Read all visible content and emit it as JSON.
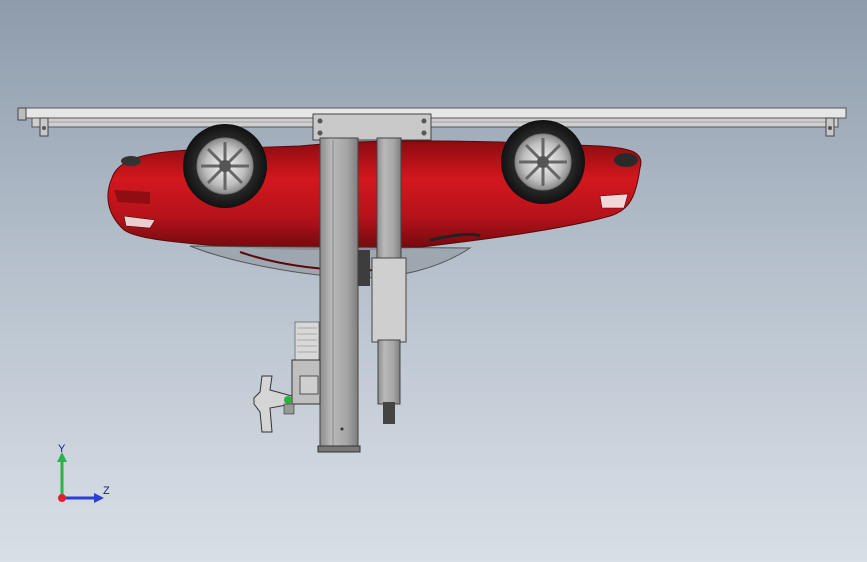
{
  "viewport": {
    "background_top": "#8e9bab",
    "background_bottom": "#d9dfe6"
  },
  "model": {
    "car_color": "#c8121a",
    "rail_color": "#d8d8d8",
    "column_color": "#a7a7a7"
  },
  "triad": {
    "y_label": "Y",
    "z_label": "Z",
    "y_color": "#2fb04a",
    "z_color": "#2a3fd6",
    "x_color": "#e0202a"
  }
}
